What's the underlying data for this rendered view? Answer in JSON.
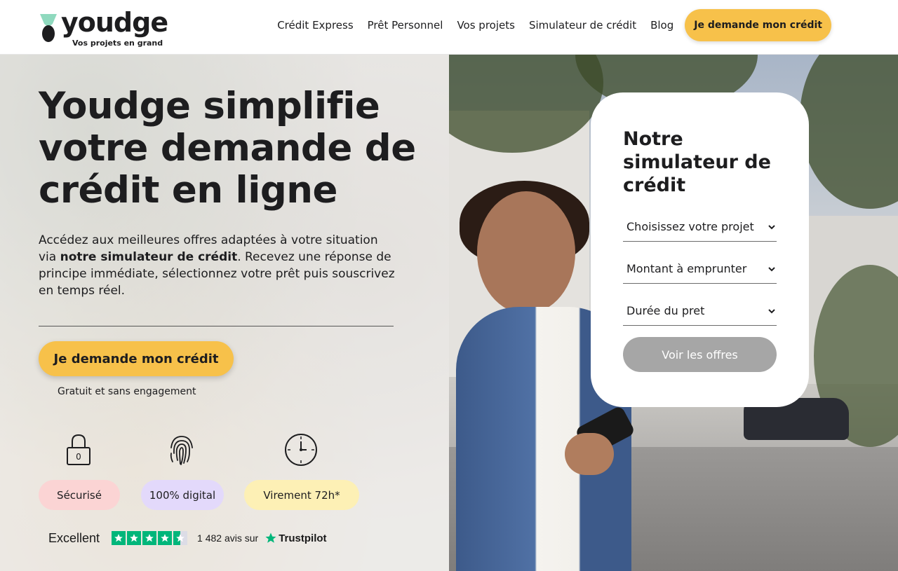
{
  "brand": {
    "name": "youdge",
    "tagline": "Vos projets en grand"
  },
  "nav": {
    "items": [
      {
        "label": "Crédit Express"
      },
      {
        "label": "Prêt Personnel"
      },
      {
        "label": "Vos projets"
      },
      {
        "label": "Simulateur de crédit"
      },
      {
        "label": "Blog"
      }
    ],
    "cta_label": "Je demande mon crédit"
  },
  "hero": {
    "title": "Youdge simplifie votre demande de crédit en ligne",
    "desc_part1": "Accédez aux meilleures offres adaptées à votre situation via ",
    "desc_bold": "notre simulateur de crédit",
    "desc_part2": ". Recevez une réponse de principe immédiate, sélectionnez votre prêt puis souscrivez en temps réel.",
    "cta_label": "Je demande mon crédit",
    "cta_note": "Gratuit et sans engagement"
  },
  "features": [
    {
      "label": "Sécurisé",
      "icon": "padlock-icon"
    },
    {
      "label": "100% digital",
      "icon": "fingerprint-icon"
    },
    {
      "label": "Virement 72h*",
      "icon": "clock-icon"
    }
  ],
  "trustpilot": {
    "rating_word": "Excellent",
    "stars": 4.5,
    "count_text": "1 482 avis sur",
    "brand": "Trustpilot"
  },
  "simulator": {
    "title": "Notre simulateur de crédit",
    "fields": [
      {
        "label": "Choisissez votre projet"
      },
      {
        "label": "Montant à emprunter"
      },
      {
        "label": "Durée du pret"
      }
    ],
    "submit_label": "Voir les offres"
  },
  "colors": {
    "accent_yellow": "#f7c14a",
    "pill_pink": "#fbd4d4",
    "pill_lavender": "#e3d9fb",
    "pill_yellow": "#fdf0b5",
    "trustpilot_green": "#00b67a",
    "button_disabled": "#a6a6a6"
  }
}
